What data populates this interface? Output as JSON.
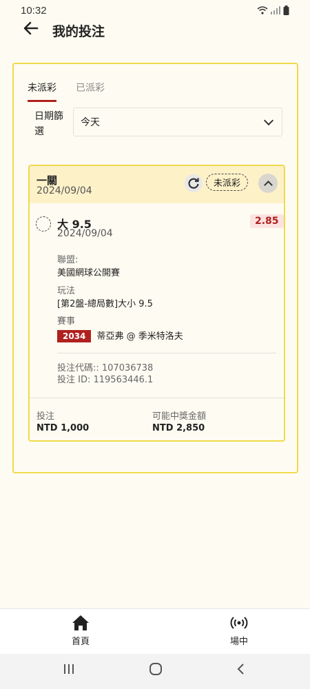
{
  "status_bar": {
    "time": "10:32"
  },
  "header": {
    "title": "我的投注"
  },
  "tabs": [
    {
      "label": "未派彩"
    },
    {
      "label": "已派彩"
    }
  ],
  "date_filter": {
    "label": "日期篩選",
    "selected": "今天"
  },
  "bet": {
    "type": "一關",
    "date": "2024/09/04",
    "status": "未派彩",
    "selection": {
      "name": "大 9.5",
      "date": "2024/09/04",
      "odds": "2.85"
    },
    "league_label": "聯盟:",
    "league_value": "美國網球公開賽",
    "play_label": "玩法",
    "play_value": "[第2盤-總局數]大小 9.5",
    "event_label": "賽事",
    "event_number": "2034",
    "event_value": "蒂亞弗 @ 季米特洛夫",
    "bet_code": "投注代碼:: 107036738",
    "bet_id": "投注 ID: 119563446.1",
    "stake_label": "投注",
    "stake_value": "NTD 1,000",
    "payout_label": "可能中獎金額",
    "payout_value": "NTD 2,850"
  },
  "bottom_nav": [
    {
      "label": "首頁",
      "icon": "home-icon"
    },
    {
      "label": "場中",
      "icon": "live-broadcast-icon"
    }
  ],
  "colors": {
    "accent": "#b0201e",
    "highlight": "#f0d94a",
    "header_bg": "#fdf1c8"
  }
}
